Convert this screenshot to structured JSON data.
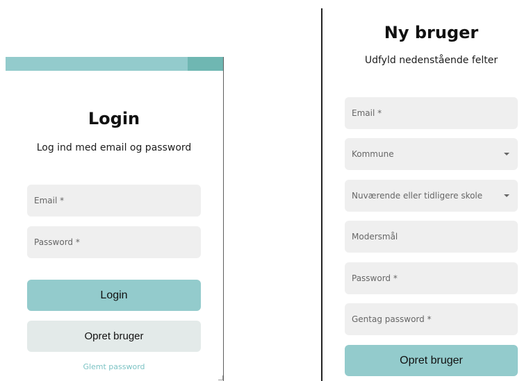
{
  "login": {
    "title": "Login",
    "subtitle": "Log ind med email og password",
    "email_placeholder": "Email *",
    "password_placeholder": "Password *",
    "login_button": "Login",
    "create_button": "Opret bruger",
    "forgot_link": "Glemt password"
  },
  "register": {
    "title": "Ny bruger",
    "subtitle": "Udfyld nedenstående felter",
    "fields": {
      "email": "Email *",
      "kommune": "Kommune",
      "skole": "Nuværende eller tidligere skole",
      "modersmaal": "Modersmål",
      "password": "Password *",
      "gentag": "Gentag password *"
    },
    "submit_button": "Opret bruger"
  },
  "colors": {
    "accent": "#93cbcc",
    "accent_dark": "#6fb7b2",
    "field_bg": "#efefef",
    "secondary_button": "#e3eae9",
    "link": "#7cc3c4"
  }
}
